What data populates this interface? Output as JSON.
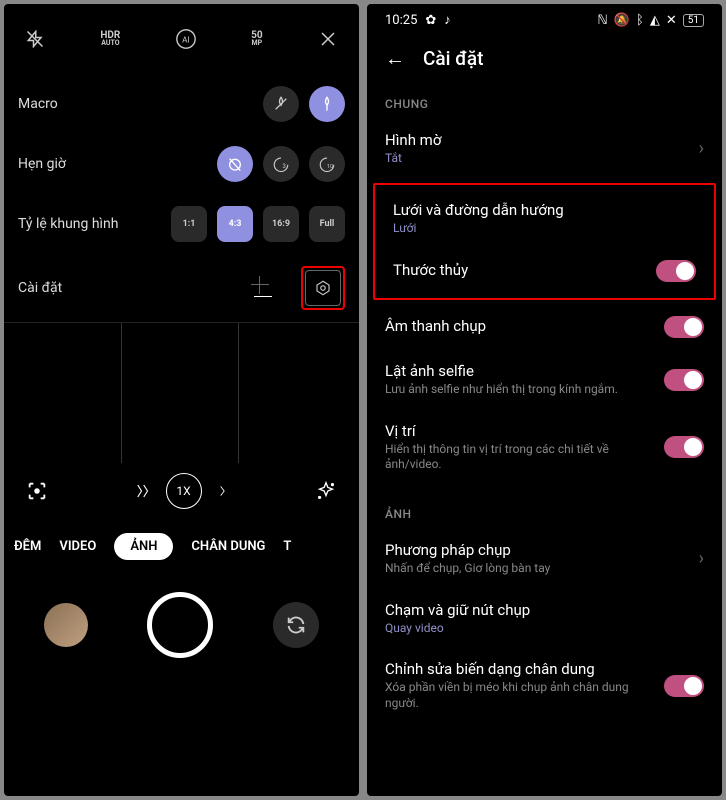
{
  "left": {
    "hdr": "HDR",
    "hdr_sub": "AUTO",
    "mp": "50",
    "mp_sub": "MP",
    "macro": "Macro",
    "timer": "Hẹn giờ",
    "ratio": "Tỷ lệ khung hình",
    "ratios": [
      "1:1",
      "4:3",
      "16:9",
      "Full"
    ],
    "timer_opts": [
      "3",
      "10"
    ],
    "settings": "Cài đặt",
    "zoom": "1X",
    "modes": [
      "ĐÊM",
      "VIDEO",
      "ẢNH",
      "CHÂN DUNG",
      "T"
    ]
  },
  "right": {
    "time": "10:25",
    "battery": "51",
    "title": "Cài đặt",
    "section_general": "CHUNG",
    "section_photo": "ẢNH",
    "watermark": {
      "title": "Hình mờ",
      "sub": "Tắt"
    },
    "grid": {
      "title": "Lưới và đường dẫn hướng",
      "sub": "Lưới"
    },
    "level": {
      "title": "Thước thủy"
    },
    "sound": {
      "title": "Âm thanh chụp"
    },
    "selfie": {
      "title": "Lật ảnh selfie",
      "sub": "Lưu ảnh selfie như hiển thị trong kính ngắm."
    },
    "location": {
      "title": "Vị trí",
      "sub": "Hiển thị thông tin vị trí trong các chi tiết về ảnh/video."
    },
    "method": {
      "title": "Phương pháp chụp",
      "sub": "Nhấn để chụp, Giơ lòng bàn tay"
    },
    "hold": {
      "title": "Chạm và giữ nút chụp",
      "sub": "Quay video"
    },
    "distort": {
      "title": "Chỉnh sửa biến dạng chân dung",
      "sub": "Xóa phần viền bị méo khi chụp ảnh chân dung người."
    }
  }
}
